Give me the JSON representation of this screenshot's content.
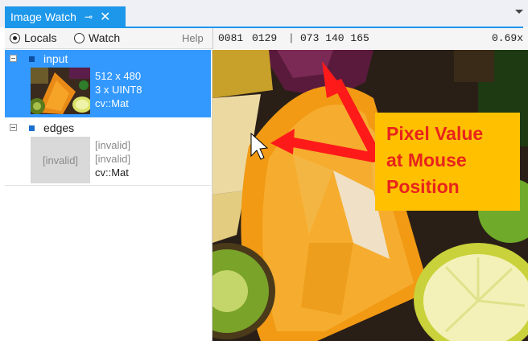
{
  "window": {
    "tab_title": "Image Watch",
    "pin_icon": "pin-icon",
    "close_glyph": "✕"
  },
  "toolbar": {
    "locals_label": "Locals",
    "watch_label": "Watch",
    "help_label": "Help",
    "selected_view": "Locals"
  },
  "pixel_info": {
    "x": "0081",
    "y": "0129",
    "values": "073 140 165",
    "zoom": "0.69x"
  },
  "variables": [
    {
      "name": "input",
      "size": "512 x 480",
      "type": "3 x UINT8",
      "class": "cv::Mat",
      "selected": true
    },
    {
      "name": "edges",
      "thumb_text": "[invalid]",
      "size": "[invalid]",
      "type": "[invalid]",
      "class": "cv::Mat",
      "selected": false
    }
  ],
  "annotation": {
    "line1": "Pixel Value",
    "line2": "at Mouse",
    "line3": "Position",
    "box_color": "#ffc000",
    "text_color": "#e8231c",
    "arrow_color": "#ff1a1a"
  },
  "colors": {
    "accent": "#1c97ea",
    "selection": "#3399ff"
  }
}
